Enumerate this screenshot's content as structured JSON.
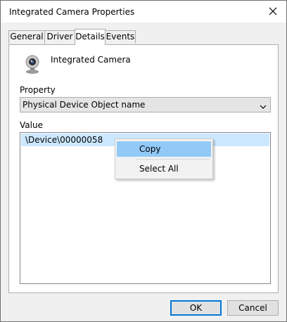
{
  "window": {
    "title": "Integrated Camera Properties"
  },
  "tabs": [
    {
      "label": "General"
    },
    {
      "label": "Driver"
    },
    {
      "label": "Details"
    },
    {
      "label": "Events"
    }
  ],
  "active_tab": "Details",
  "device": {
    "icon": "webcam-icon",
    "name": "Integrated Camera"
  },
  "property": {
    "label": "Property",
    "selected": "Physical Device Object name"
  },
  "value": {
    "label": "Value",
    "items": [
      "\\Device\\00000058"
    ]
  },
  "context_menu": {
    "items": [
      {
        "label": "Copy"
      },
      {
        "label": "Select All"
      }
    ],
    "highlighted": "Copy"
  },
  "buttons": {
    "ok": "OK",
    "cancel": "Cancel"
  },
  "colors": {
    "accent": "#0078d7",
    "selection": "#cce8ff",
    "menu_highlight": "#91c9f7"
  }
}
